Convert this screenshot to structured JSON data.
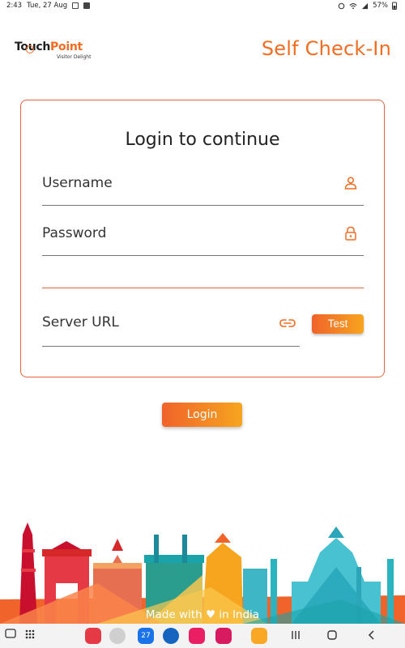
{
  "status_bar": {
    "time": "2:43",
    "date": "Tue, 27 Aug",
    "battery": "57%"
  },
  "header": {
    "logo_text_1": "Touch",
    "logo_text_2": "Point",
    "logo_tagline": "Visitor Delight",
    "title": "Self Check-In"
  },
  "login_card": {
    "title": "Login to continue",
    "username_label": "Username",
    "password_label": "Password",
    "server_url_label": "Server URL",
    "test_button": "Test"
  },
  "login_button": "Login",
  "footer": {
    "made_with": "Made with",
    "heart": "♥",
    "in_india": "in India"
  },
  "nav_bar": {
    "calendar_day": "27"
  },
  "colors": {
    "accent": "#f26c22",
    "button_gradient_start": "#f0632a",
    "button_gradient_end": "#f7a51f",
    "card_border": "#e8643c"
  },
  "icons": {
    "username": "person-icon",
    "password": "lock-icon",
    "server_url": "link-icon"
  }
}
